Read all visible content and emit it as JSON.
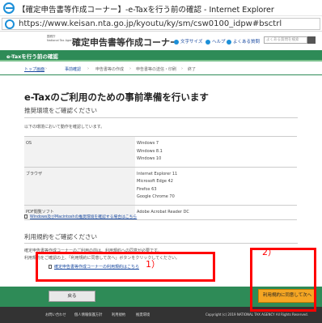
{
  "window": {
    "title": "【確定申告書等作成コーナー】-e-Taxを行う前の確認 - Internet Explorer"
  },
  "address": {
    "url": "https://www.keisan.nta.go.jp/kyoutu/ky/sm/csw0100_idpw#bsctrl"
  },
  "header": {
    "org": [
      "国税庁",
      "National Tax Agency"
    ],
    "site_title": "確定申告書等作成コーナー",
    "links": {
      "print": "文字サイズ",
      "sitemap": "ヘルプ",
      "faq": "よくある質問"
    },
    "search_placeholder": "よくある質問を検索"
  },
  "green_bar": {
    "title": "e-Taxを行う前の確認"
  },
  "breadcrumb": [
    "トップ画面",
    "事前確認",
    "申告書等の作成",
    "申告書等の送信・印刷",
    "終了"
  ],
  "main": {
    "title": "e-Taxのご利用のための事前準備を行います",
    "env_heading": "推奨環境をご確認ください",
    "env_note": "以下の環境において動作を確認しています。",
    "env_rows": [
      {
        "key": "OS",
        "values": [
          "Windows 7",
          "Windows 8.1",
          "Windows 10"
        ]
      },
      {
        "key": "ブラウザ",
        "values": [
          "Internet Explorer 11",
          "Microsoft Edge 42",
          "Firefox 63",
          "Google Chrome 70"
        ]
      },
      {
        "key": "PDF閲覧ソフト",
        "values": [
          "Adobe Acrobat Reader DC"
        ]
      }
    ],
    "env_link": "Windows及びMacintoshの推奨環境を確認する場合はこちら",
    "terms_heading": "利用規約をご確認ください",
    "terms_note_1": "確定申告書等作成コーナーのご利用の前は、利用規約への同意が必要です。",
    "terms_note_2": "利用規約をご確認の上、「利用規約に同意して次へ」ボタンをクリックしてください。",
    "terms_link": "確定申告書等作成コーナーの利用規約はこちら"
  },
  "buttons": {
    "back": "戻る",
    "next": "利用規約に同意して次へ"
  },
  "footer": {
    "links": [
      "お問い合わせ",
      "個人情報保護方針",
      "利用規約",
      "推奨環境"
    ],
    "copyright": "Copyright (c) 2019 NATIONAL TAX AGENCY All Rights Reserved."
  },
  "annotations": {
    "label_1": "1）",
    "label_2": "2）",
    "color": "#ff0000"
  },
  "colors": {
    "brand_green": "#2e8b57",
    "next_button": "#f5a623",
    "link": "#1a4aa0"
  }
}
